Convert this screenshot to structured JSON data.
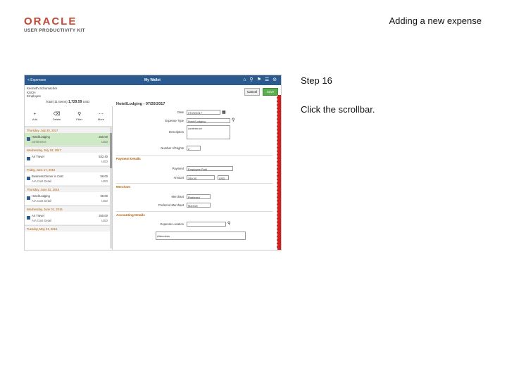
{
  "header": {
    "logo_oracle": "ORACLE",
    "logo_upk": "USER PRODUCTIVITY KIT",
    "slide_title": "Adding a new expense"
  },
  "step": {
    "label": "Step 16",
    "instruction": "Click the scrollbar."
  },
  "screenshot": {
    "topbar": {
      "back": "< Expenses",
      "title": "My Wallet"
    },
    "person": {
      "name": "Kenneth Schumacher",
      "id": "KSCH",
      "role": "Employee"
    },
    "total": {
      "label": "Total (11 Items)",
      "amount": "1,729.59",
      "currency": "USD"
    },
    "buttons": {
      "cancel": "Cancel",
      "save": "Save"
    },
    "tools": [
      {
        "glyph": "+",
        "label": "Add"
      },
      {
        "glyph": "⌫",
        "label": "Delete"
      },
      {
        "glyph": "⚲",
        "label": "Filter"
      },
      {
        "glyph": "⋯",
        "label": "More"
      }
    ],
    "groups": [
      {
        "day": "Thursday, July 20, 2017",
        "items": [
          {
            "d1": "Hotel/Lodging",
            "d2": "conference",
            "amt": "250.00",
            "cur": "USD",
            "selected": true
          }
        ]
      },
      {
        "day": "Wednesday, July 19, 2017",
        "items": [
          {
            "d1": "Air Travel",
            "d2": "",
            "amt": "532.40",
            "cur": "USD",
            "selected": false
          }
        ]
      },
      {
        "day": "Friday, June 17, 2016",
        "items": [
          {
            "d1": "Business Dinner in Cost",
            "d2": "AIA Cost Detail",
            "amt": "56.00",
            "cur": "USD",
            "selected": false
          }
        ]
      },
      {
        "day": "Thursday, June 02, 2016",
        "items": [
          {
            "d1": "Hotel/Lodging",
            "d2": "AIA Cost Detail",
            "amt": "99.00",
            "cur": "USD",
            "selected": false
          }
        ]
      },
      {
        "day": "Wednesday, June 01, 2016",
        "items": [
          {
            "d1": "Air Travel",
            "d2": "AIA Cost Detail",
            "amt": "250.00",
            "cur": "USD",
            "selected": false
          }
        ]
      },
      {
        "day": "Tuesday, May 31, 2016",
        "items": []
      }
    ],
    "detail": {
      "title": "Hotel/Lodging - 07/20/2017",
      "date_label": "Date",
      "date_value": "07/20/2017",
      "type_label": "Expense Type",
      "type_value": "Hotel/Lodging",
      "desc_label": "Description",
      "desc_value": "conference",
      "nights_label": "Number of Nights",
      "nights_value": "2",
      "payment_section": "Payment Details",
      "payment_label": "Payment",
      "payment_value": "Employee Paid",
      "amount_label": "Amount",
      "amount_value": "250.00",
      "amount_currency": "USD",
      "merchant_section": "Merchant",
      "merchant_label": "Merchant",
      "merchant_value": "Preferred",
      "pref_merchant_label": "Preferred Merchant",
      "pref_merchant_value": "Marriott",
      "accounting_section": "Accounting Details",
      "location_label": "Expense Location",
      "attendees_label": "Attendees"
    }
  }
}
